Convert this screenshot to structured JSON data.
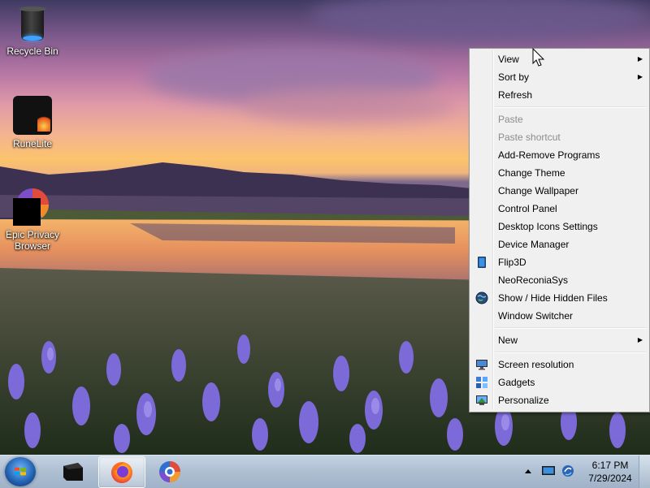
{
  "desktop": {
    "icons": [
      {
        "label": "Recycle Bin",
        "icon": "recycle-bin-icon"
      },
      {
        "label": "RuneLite",
        "icon": "runelite-icon"
      },
      {
        "label": "Epic Privacy Browser",
        "icon": "epic-privacy-browser-icon"
      }
    ]
  },
  "context_menu": {
    "items": [
      {
        "label": "View",
        "submenu": true
      },
      {
        "label": "Sort by",
        "submenu": true
      },
      {
        "label": "Refresh"
      },
      {
        "label": "Paste",
        "disabled": true
      },
      {
        "label": "Paste shortcut",
        "disabled": true
      },
      {
        "label": "Add-Remove Programs"
      },
      {
        "label": "Change Theme"
      },
      {
        "label": "Change Wallpaper"
      },
      {
        "label": "Control Panel"
      },
      {
        "label": "Desktop Icons Settings"
      },
      {
        "label": "Device Manager"
      },
      {
        "label": "Flip3D",
        "icon": "flip3d-icon"
      },
      {
        "label": "NeoReconiaSys"
      },
      {
        "label": "Show / Hide Hidden Files",
        "icon": "globe-icon"
      },
      {
        "label": "Window Switcher"
      },
      {
        "label": "New",
        "submenu": true
      },
      {
        "label": "Screen resolution",
        "icon": "monitor-icon"
      },
      {
        "label": "Gadgets",
        "icon": "gadgets-icon"
      },
      {
        "label": "Personalize",
        "icon": "personalize-icon"
      }
    ]
  },
  "taskbar": {
    "pinned": [
      {
        "name": "app-black-box"
      },
      {
        "name": "firefox",
        "active": true
      },
      {
        "name": "epic-browser"
      }
    ],
    "clock": {
      "time": "6:17 PM",
      "date": "7/29/2024"
    },
    "tray_icons": [
      "show-hidden-icons-arrow",
      "action-center-icon",
      "network-icon"
    ]
  }
}
